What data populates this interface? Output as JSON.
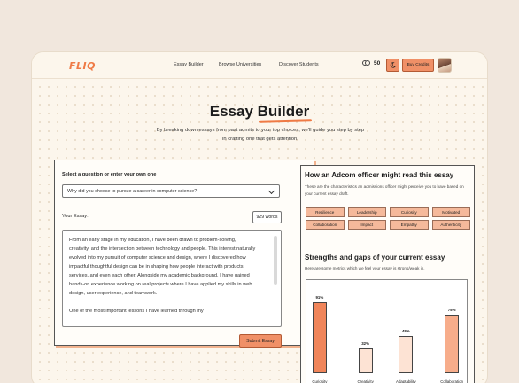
{
  "nav": {
    "logo": "FLIQ",
    "links": [
      "Essay Builder",
      "Browse Universities",
      "Discover Students"
    ],
    "credits": "50",
    "buy_label": "Buy Credits"
  },
  "hero": {
    "title_plain": "Essay ",
    "title_highlight": "Builder",
    "subtitle": "By breaking down essays from past admits to your top choices, we'll guide you step by step in crafting one that gets attention."
  },
  "editor": {
    "question_label": "Select a question or enter your own one",
    "question_value": "Why did you choose to pursue a career in computer science?",
    "essay_label": "Your Essay:",
    "word_count": "929 words",
    "essay_text": "From an early stage in my education, I have been drawn to problem-solving, creativity, and the intersection between technology and people. This interest naturally evolved into my pursuit of computer science and design, where I discovered how impactful thoughtful design can be in shaping how people interact with products, services, and even each other. Alongside my academic background, I have gained hands-on experience working on real projects where I have applied my skills in web design, user experience, and teamwork.\n\nOne of the most important lessons I have learned through my",
    "submit_label": "Submit Essay"
  },
  "adcom": {
    "heading": "How an Adcom officer might read this essay",
    "description": "These are the characteristics an admissions officer might perceive you to have based on your current essay draft.",
    "tags": [
      "Resilience",
      "Leadership",
      "Curiosity",
      "Motivated",
      "Collaboration",
      "Impact",
      "Empathy",
      "Authenticity"
    ]
  },
  "metrics": {
    "heading": "Strengths and gaps of your current essay",
    "description": "Here are some metrics which we feel your essay is strong/weak in."
  },
  "chart_data": {
    "type": "bar",
    "categories": [
      "Curiosity",
      "Creativity",
      "Adaptability",
      "Collaboration"
    ],
    "values": [
      91,
      32,
      48,
      75
    ],
    "value_labels": [
      "91%",
      "32%",
      "48%",
      "75%"
    ],
    "ylim": [
      0,
      100
    ],
    "colors": [
      "#f0855a",
      "#fde3d4",
      "#fde3d4",
      "#f7ad8b"
    ]
  },
  "colors": {
    "accent": "#ef7a45",
    "button": "#f09067",
    "tag": "#f5b99b",
    "background": "#fcf6ec"
  }
}
